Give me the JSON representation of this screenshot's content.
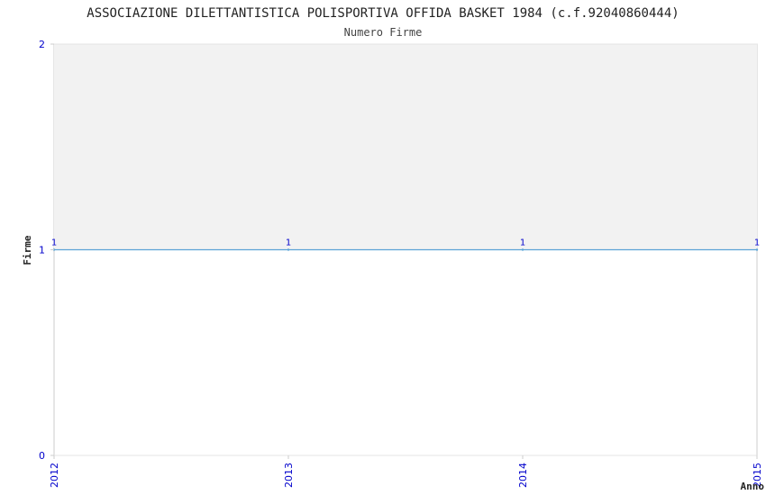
{
  "chart_data": {
    "type": "line",
    "title": "ASSOCIAZIONE DILETTANTISTICA POLISPORTIVA OFFIDA BASKET 1984 (c.f.92040860444)",
    "subtitle": "Numero Firme",
    "xlabel": "Anno",
    "ylabel": "Firme",
    "x": [
      2012,
      2013,
      2014,
      2015
    ],
    "series": [
      {
        "values": [
          1,
          1,
          1,
          1
        ]
      }
    ],
    "xticks": [
      "2012",
      "2013",
      "2014",
      "2015"
    ],
    "yticks": [
      "0",
      "1",
      "2"
    ],
    "ylim": [
      0,
      2
    ],
    "grid": true,
    "colors": {
      "line": "#5ba3d6",
      "fill_above": "#f2f2f2",
      "axis_text": "#0000cc",
      "title_text": "#222222",
      "axis_line": "#cccccc"
    }
  }
}
